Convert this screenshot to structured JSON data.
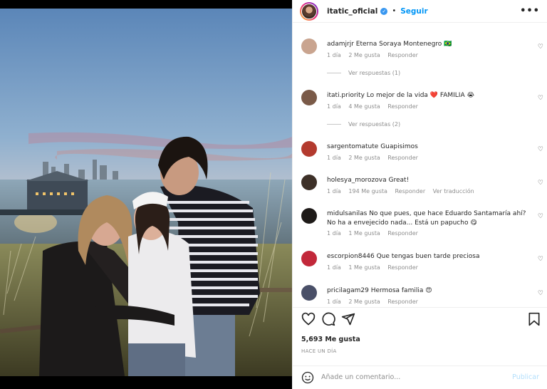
{
  "post": {
    "username": "itatic_oficial",
    "follow_label": "Seguir",
    "likes": "5,693 Me gusta",
    "time_ago": "HACE UN DÍA",
    "comment_placeholder": "Añade un comentario...",
    "publish_label": "Publicar"
  },
  "comments": [
    {
      "user": "adamjrjr",
      "text": "Eterna Soraya Montenegro 🇧🇷",
      "time": "1 día",
      "likes": "2 Me gusta",
      "reply": "Responder",
      "extra": "",
      "view_replies": "Ver respuestas (1)",
      "avatar_color": "#c9a48f"
    },
    {
      "user": "itati.priority",
      "text": "Lo mejor de la vida ❤️ FAMILIA 😭",
      "time": "1 día",
      "likes": "4 Me gusta",
      "reply": "Responder",
      "extra": "",
      "view_replies": "Ver respuestas (2)",
      "avatar_color": "#7a5a48"
    },
    {
      "user": "sargentomatute",
      "text": "Guapisimos",
      "time": "1 día",
      "likes": "2 Me gusta",
      "reply": "Responder",
      "extra": "",
      "view_replies": "",
      "avatar_color": "#b33a2e"
    },
    {
      "user": "holesya_morozova",
      "text": "Great!",
      "time": "1 día",
      "likes": "194 Me gusta",
      "reply": "Responder",
      "extra": "Ver traducción",
      "view_replies": "",
      "avatar_color": "#3d3028"
    },
    {
      "user": "midulsanilas",
      "text": "No que pues, que hace Eduardo Santamaría ahí? No ha a envejecido nada... Está un papucho 😋",
      "time": "1 día",
      "likes": "1 Me gusta",
      "reply": "Responder",
      "extra": "",
      "view_replies": "",
      "avatar_color": "#1e1a18"
    },
    {
      "user": "escorpion8446",
      "text": "Que tengas buen tarde preciosa",
      "time": "1 día",
      "likes": "1 Me gusta",
      "reply": "Responder",
      "extra": "",
      "view_replies": "",
      "avatar_color": "#c2283a"
    },
    {
      "user": "pricilagam29",
      "text": "Hermosa familia 😍",
      "time": "1 día",
      "likes": "2 Me gusta",
      "reply": "Responder",
      "extra": "",
      "view_replies": "",
      "avatar_color": "#4a5068"
    }
  ]
}
